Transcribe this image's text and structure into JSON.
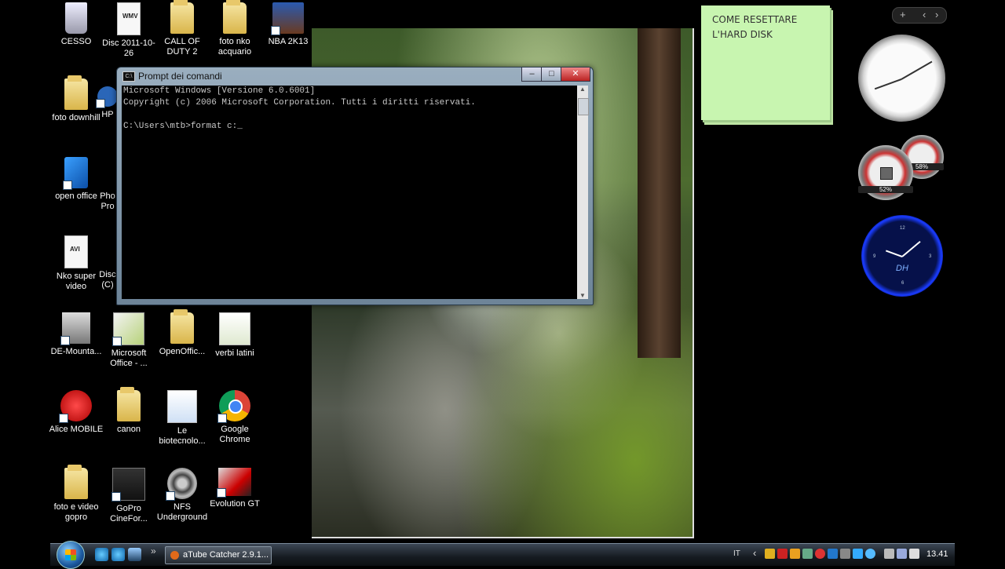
{
  "desktop": {
    "icons": [
      {
        "label": "CESSO",
        "kind": "recycle-bin"
      },
      {
        "label": "Disc 2011-10-26",
        "kind": "video-file",
        "badge": "WMV"
      },
      {
        "label": "CALL OF DUTY 2",
        "kind": "folder"
      },
      {
        "label": "foto nko acquario",
        "kind": "folder"
      },
      {
        "label": "NBA 2K13",
        "kind": "game-shortcut"
      },
      {
        "label": "foto downhill",
        "kind": "folder"
      },
      {
        "label": "HP",
        "kind": "shortcut"
      },
      {
        "label": "open office",
        "kind": "installer"
      },
      {
        "label": "Pho Pro",
        "kind": "shortcut"
      },
      {
        "label": "Nko super video",
        "kind": "video-file",
        "badge": "AVI"
      },
      {
        "label": "Disc (C)",
        "kind": "shortcut"
      },
      {
        "label": "DE-Mounta...",
        "kind": "tool"
      },
      {
        "label": "Microsoft Office - ...",
        "kind": "shortcut"
      },
      {
        "label": "OpenOffic...",
        "kind": "folder"
      },
      {
        "label": "verbi latini",
        "kind": "spreadsheet"
      },
      {
        "label": "Alice MOBILE",
        "kind": "shortcut"
      },
      {
        "label": "canon",
        "kind": "folder"
      },
      {
        "label": "Le biotecnolo...",
        "kind": "word-document"
      },
      {
        "label": "Google Chrome",
        "kind": "chrome-shortcut"
      },
      {
        "label": "foto e video gopro",
        "kind": "folder"
      },
      {
        "label": "GoPro CineFor...",
        "kind": "shortcut"
      },
      {
        "label": "NFS Underground",
        "kind": "game-shortcut"
      },
      {
        "label": "Evolution GT",
        "kind": "game-shortcut"
      }
    ]
  },
  "console": {
    "title": "Prompt dei comandi",
    "icon_text": "C:\\",
    "lines": [
      "Microsoft Windows [Versione 6.0.6001]",
      "Copyright (c) 2006 Microsoft Corporation. Tutti i diritti riservati.",
      "",
      "C:\\Users\\mtb>format c:_"
    ],
    "minimize": "–",
    "maximize": "□",
    "close": "✕"
  },
  "note": {
    "line1": "COME RESETTARE",
    "line2": "L'HARD DISK"
  },
  "gadgets": {
    "sidebar_add": "+",
    "sidebar_prev": "‹",
    "sidebar_next": "›",
    "cpu_percent": "52%",
    "memory_percent": "58%",
    "blue_clock_text": "DH"
  },
  "taskbar": {
    "task_label": "aTube Catcher 2.9.1...",
    "more_label": "»",
    "lang": "IT",
    "chevron": "‹",
    "time": "13.41"
  },
  "colors": {
    "note_bg": "#c8f5b0",
    "desktop_bg": "#000000"
  }
}
